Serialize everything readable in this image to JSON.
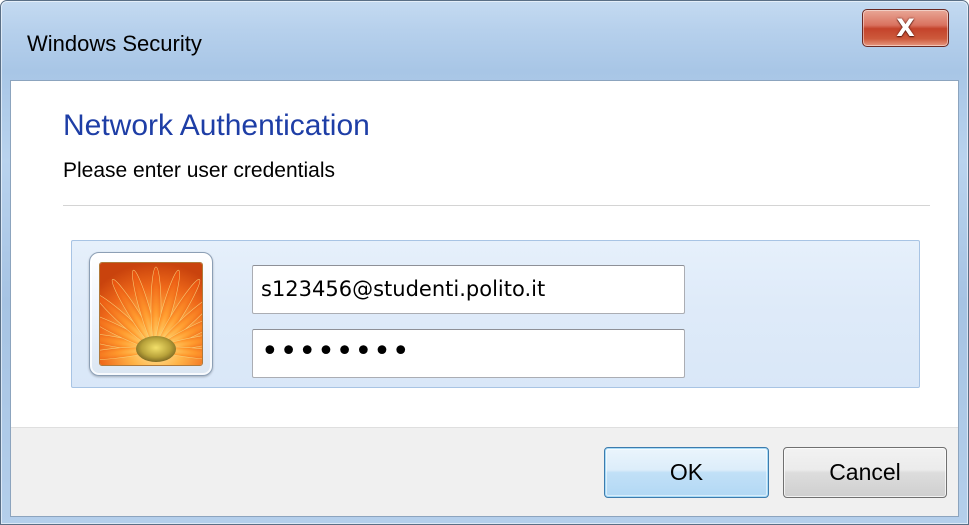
{
  "window": {
    "title": "Windows Security",
    "close_glyph": "X",
    "close_icon": "close-icon"
  },
  "dialog": {
    "heading": "Network Authentication",
    "subheading": "Please enter user credentials"
  },
  "credentials": {
    "avatar_icon": "user-tile-flower-icon",
    "username_value": "s123456@studenti.polito.it",
    "password_value": "••••••••"
  },
  "buttons": {
    "ok_label": "OK",
    "cancel_label": "Cancel"
  },
  "colors": {
    "heading": "#1e3ea6",
    "frame": "#b6d0ec",
    "close_button": "#c4432b",
    "default_button": "#b2d8f4"
  }
}
